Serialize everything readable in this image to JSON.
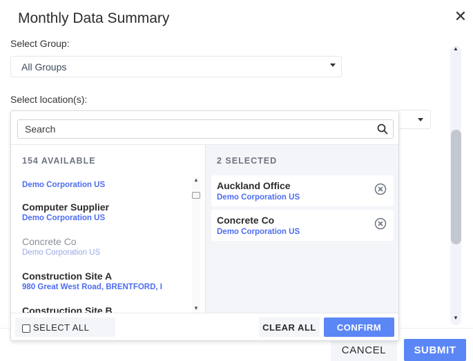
{
  "dialog": {
    "title": "Monthly Data Summary",
    "close_icon": "close-icon"
  },
  "form": {
    "group_label": "Select Group:",
    "group_value": "All Groups",
    "location_label": "Select location(s):"
  },
  "picker": {
    "search_placeholder": "Search",
    "available_header": "154 AVAILABLE",
    "selected_header": "2 SELECTED",
    "available_items": [
      {
        "name": "",
        "sub": "Demo Corporation US",
        "disabled": false
      },
      {
        "name": "Computer Supplier",
        "sub": "Demo Corporation US",
        "disabled": false
      },
      {
        "name": "Concrete Co",
        "sub": "Demo Corporation US",
        "disabled": true
      },
      {
        "name": "Construction Site A",
        "sub": "980 Great West Road, BRENTFORD, I",
        "disabled": false
      },
      {
        "name": "Construction Site B",
        "sub": "",
        "disabled": false
      }
    ],
    "selected_items": [
      {
        "name": "Auckland Office",
        "sub": "Demo Corporation US"
      },
      {
        "name": "Concrete Co",
        "sub": "Demo Corporation US"
      }
    ],
    "select_all_label": "SELECT ALL",
    "clear_all_label": "CLEAR ALL",
    "confirm_label": "CONFIRM"
  },
  "footer": {
    "cancel_label": "CANCEL",
    "submit_label": "SUBMIT"
  },
  "colors": {
    "accent": "#5b86f5",
    "link": "#4d6df0",
    "panel_bg": "#f3f5f9"
  }
}
